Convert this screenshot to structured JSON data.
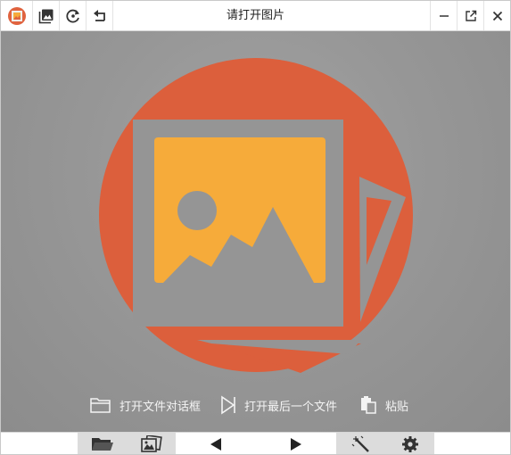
{
  "window": {
    "title": "请打开图片"
  },
  "toolbar": {
    "buttons": [
      {
        "name": "app-logo-icon"
      },
      {
        "name": "gallery-icon"
      },
      {
        "name": "refresh-icon"
      },
      {
        "name": "undo-icon"
      }
    ]
  },
  "window_controls": [
    "minimize-icon",
    "popout-icon",
    "close-icon"
  ],
  "actions": {
    "open_dialog": "打开文件对话框",
    "open_last": "打开最后一个文件",
    "paste": "粘贴"
  },
  "bottombar": {
    "buttons": [
      "open-folder-icon",
      "gallery-icon",
      "previous-icon",
      "next-icon",
      "magic-wand-icon",
      "settings-icon"
    ]
  },
  "colors": {
    "accent_red": "#dc5f3c",
    "accent_orange": "#f6ab3a",
    "frame_gray": "#959595",
    "content_gray": "#979797"
  }
}
